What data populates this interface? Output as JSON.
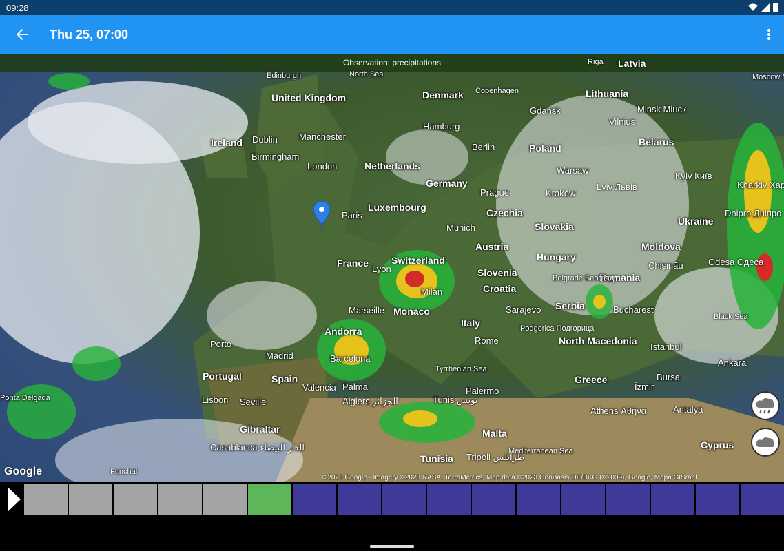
{
  "status": {
    "time": "09:28"
  },
  "appbar": {
    "title": "Thu 25, 07:00"
  },
  "map": {
    "observation": "Observation: precipitations",
    "labels": [
      {
        "t": "Edinburgh",
        "c": "small"
      },
      {
        "t": "North Sea",
        "c": "small"
      },
      {
        "t": "United Kingdom",
        "c": "country"
      },
      {
        "t": "Denmark",
        "c": "country"
      },
      {
        "t": "Copenhagen",
        "c": "small"
      },
      {
        "t": "Lithuania",
        "c": "country"
      },
      {
        "t": "Ireland",
        "c": "country"
      },
      {
        "t": "Dublin",
        "c": ""
      },
      {
        "t": "Manchester",
        "c": ""
      },
      {
        "t": "Birmingham",
        "c": ""
      },
      {
        "t": "London",
        "c": ""
      },
      {
        "t": "Hamburg",
        "c": ""
      },
      {
        "t": "Gdańsk",
        "c": ""
      },
      {
        "t": "Minsk Мінск",
        "c": ""
      },
      {
        "t": "Vilnius",
        "c": ""
      },
      {
        "t": "Belarus",
        "c": "country"
      },
      {
        "t": "Berlin",
        "c": ""
      },
      {
        "t": "Poland",
        "c": "country"
      },
      {
        "t": "Netherlands",
        "c": "country"
      },
      {
        "t": "Warsaw",
        "c": ""
      },
      {
        "t": "Germany",
        "c": "country"
      },
      {
        "t": "Prague",
        "c": ""
      },
      {
        "t": "Kraków",
        "c": ""
      },
      {
        "t": "Lviv Львів",
        "c": ""
      },
      {
        "t": "Kyiv Київ",
        "c": ""
      },
      {
        "t": "Luxembourg",
        "c": "country"
      },
      {
        "t": "Paris",
        "c": ""
      },
      {
        "t": "Czechia",
        "c": "country"
      },
      {
        "t": "Slovakia",
        "c": "country"
      },
      {
        "t": "Munich",
        "c": ""
      },
      {
        "t": "Ukraine",
        "c": "country"
      },
      {
        "t": "Kharkiv Харків",
        "c": ""
      },
      {
        "t": "Dnipro Дніпро",
        "c": ""
      },
      {
        "t": "Austria",
        "c": "country"
      },
      {
        "t": "Moldova",
        "c": "country"
      },
      {
        "t": "Switzerland",
        "c": "country"
      },
      {
        "t": "France",
        "c": "country"
      },
      {
        "t": "Lyon",
        "c": ""
      },
      {
        "t": "Slovenia",
        "c": "country"
      },
      {
        "t": "Hungary",
        "c": "country"
      },
      {
        "t": "Chișinău",
        "c": ""
      },
      {
        "t": "Odesa Одеса",
        "c": ""
      },
      {
        "t": "Milan",
        "c": ""
      },
      {
        "t": "Croatia",
        "c": "country"
      },
      {
        "t": "Romania",
        "c": "country"
      },
      {
        "t": "Belgrade Београд",
        "c": "small"
      },
      {
        "t": "Marseille",
        "c": ""
      },
      {
        "t": "Monaco",
        "c": "country"
      },
      {
        "t": "Sarajevo",
        "c": ""
      },
      {
        "t": "Serbia",
        "c": "country"
      },
      {
        "t": "Bucharest",
        "c": ""
      },
      {
        "t": "Black Sea",
        "c": "small"
      },
      {
        "t": "Andorra",
        "c": "country"
      },
      {
        "t": "Italy",
        "c": "country"
      },
      {
        "t": "Podgorica Подгорица",
        "c": "small"
      },
      {
        "t": "Rome",
        "c": ""
      },
      {
        "t": "North Macedonia",
        "c": "country"
      },
      {
        "t": "Istanbul",
        "c": ""
      },
      {
        "t": "Porto",
        "c": ""
      },
      {
        "t": "Madrid",
        "c": ""
      },
      {
        "t": "Barcelona",
        "c": ""
      },
      {
        "t": "Ankara",
        "c": ""
      },
      {
        "t": "Portugal",
        "c": "country"
      },
      {
        "t": "Spain",
        "c": "country"
      },
      {
        "t": "Tyrrhenian Sea",
        "c": "small"
      },
      {
        "t": "Greece",
        "c": "country"
      },
      {
        "t": "Bursa",
        "c": ""
      },
      {
        "t": "Valencia",
        "c": ""
      },
      {
        "t": "Palma",
        "c": ""
      },
      {
        "t": "İzmir",
        "c": ""
      },
      {
        "t": "Lisbon",
        "c": ""
      },
      {
        "t": "Seville",
        "c": ""
      },
      {
        "t": "Algiers الجزائر",
        "c": ""
      },
      {
        "t": "Tunis تونس",
        "c": ""
      },
      {
        "t": "Palermo",
        "c": ""
      },
      {
        "t": "Athens Αθήνα",
        "c": ""
      },
      {
        "t": "Antalya",
        "c": ""
      },
      {
        "t": "Gibraltar",
        "c": "country"
      },
      {
        "t": "Malta",
        "c": "country"
      },
      {
        "t": "Cyprus",
        "c": "country"
      },
      {
        "t": "Casablanca الدار البيضاء",
        "c": ""
      },
      {
        "t": "Tunisia",
        "c": "country"
      },
      {
        "t": "Tripoli طرابلس",
        "c": ""
      },
      {
        "t": "Mediterranean Sea",
        "c": "small"
      },
      {
        "t": "Ponta Delgada",
        "c": "small"
      },
      {
        "t": "Funchal",
        "c": "small"
      },
      {
        "t": "Moscow Москва",
        "c": "small"
      },
      {
        "t": "Riga",
        "c": "small"
      },
      {
        "t": "Latvia",
        "c": "country"
      }
    ],
    "google": "Google",
    "copyright": "©2023 Google - Imagery ©2023 NASA, TerraMetrics, Map data ©2023 GeoBasis-DE/BKG (©2009), Google, Mapa GISrael"
  },
  "timeline": {
    "slots": [
      "past",
      "past",
      "past",
      "past",
      "past",
      "current",
      "future",
      "future",
      "future",
      "future",
      "future",
      "future",
      "future",
      "future",
      "future",
      "future",
      "future"
    ],
    "colors": {
      "past": "#a4a4a4",
      "current": "#5db75a",
      "future": "#3f3a98"
    }
  }
}
